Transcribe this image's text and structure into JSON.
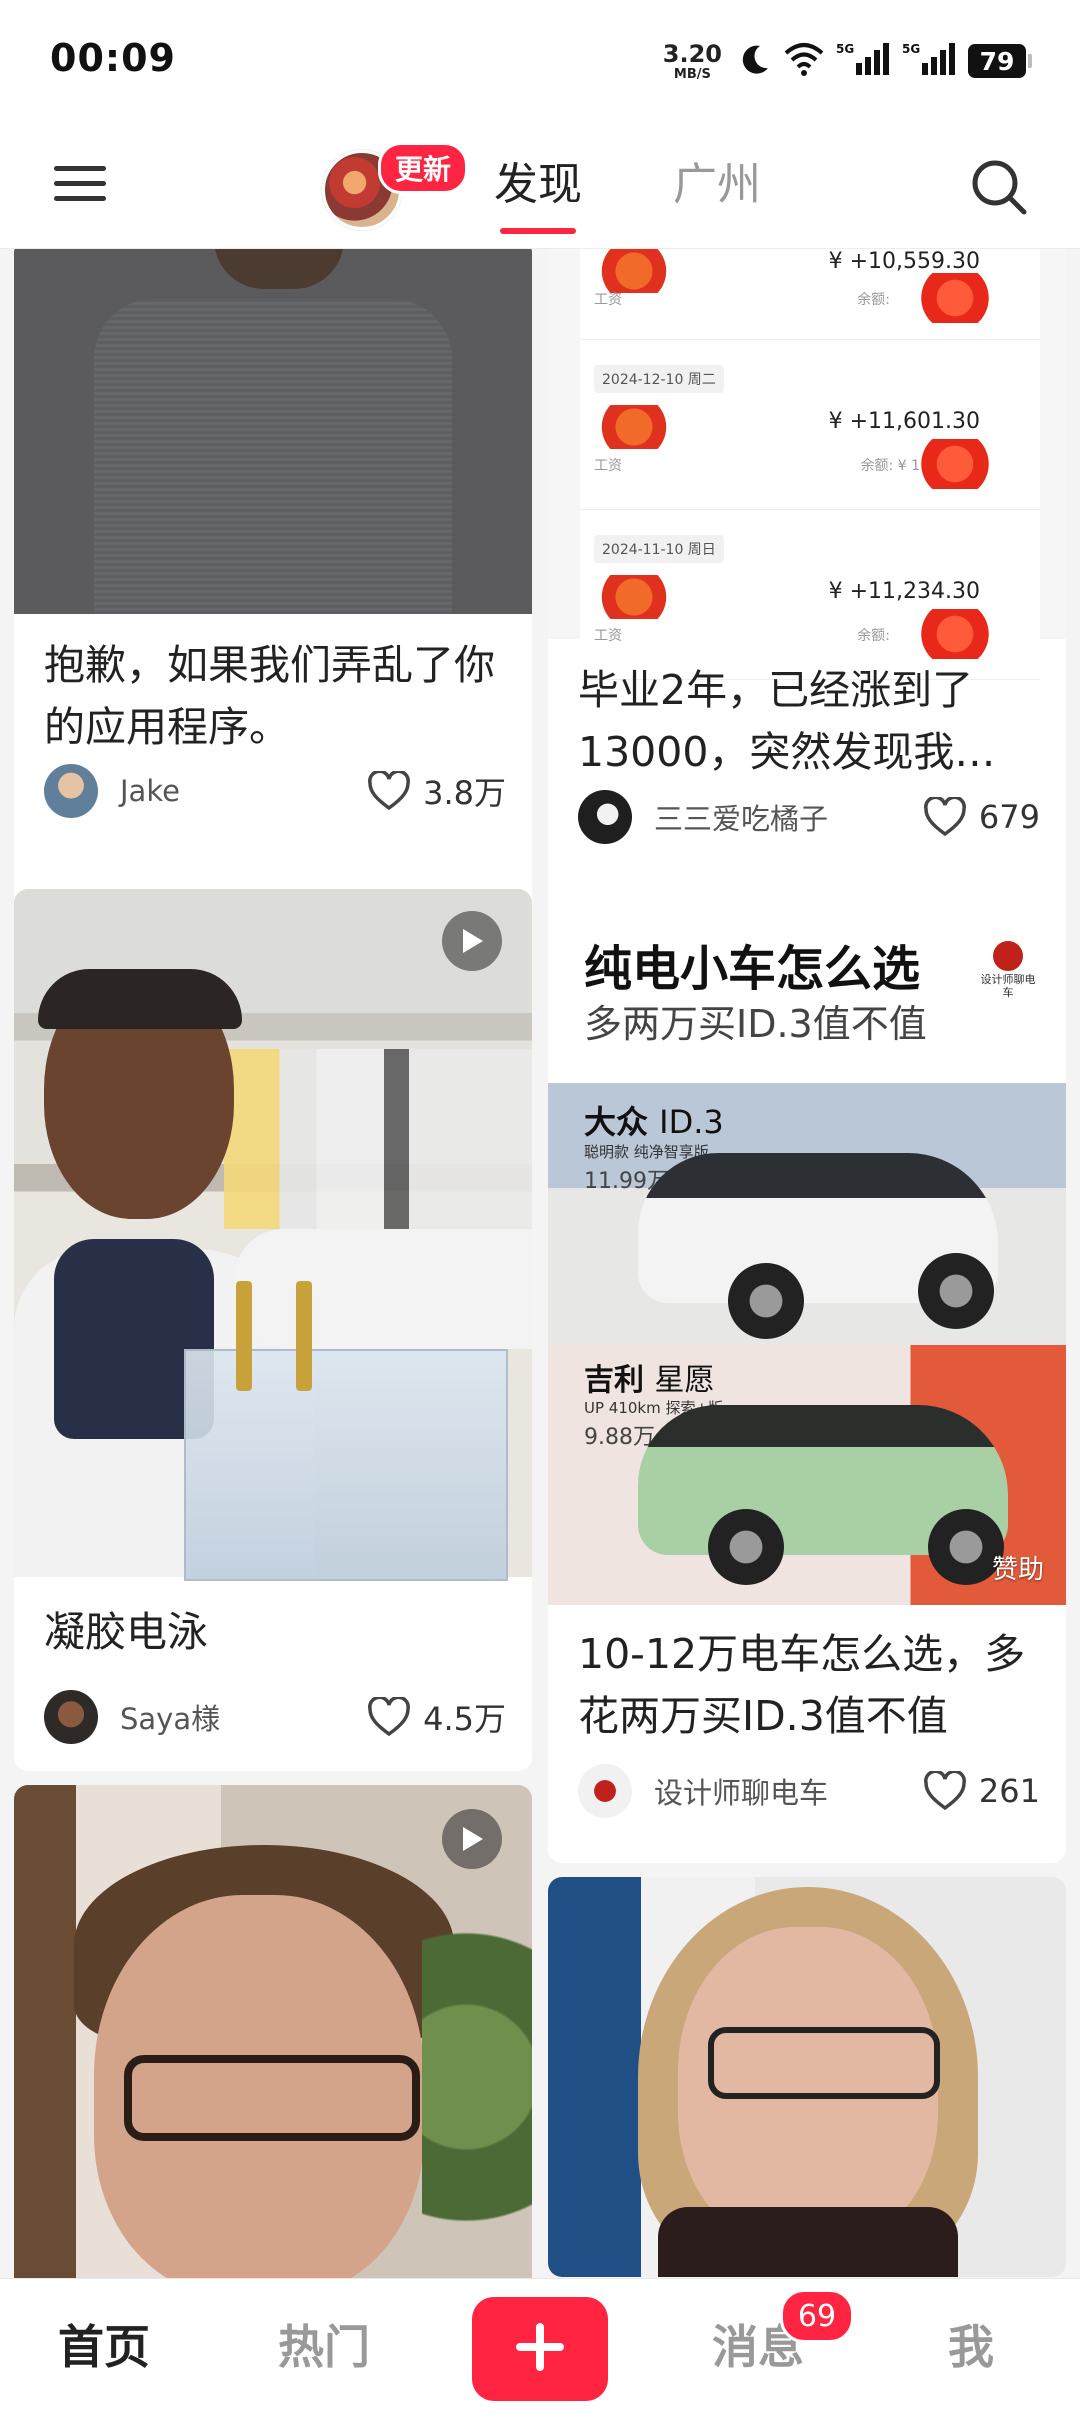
{
  "status_bar": {
    "time": "00:09",
    "net_speed_value": "3.20",
    "net_speed_unit": "MB/S",
    "signal_1_label": "5G",
    "signal_2_label": "5G",
    "battery": "79"
  },
  "top_nav": {
    "update_badge": "更新",
    "tabs": [
      {
        "label": "发现",
        "active": true
      },
      {
        "label": "广州",
        "active": false
      }
    ]
  },
  "feed": {
    "cards": [
      {
        "title": "抱歉，如果我们弄乱了你的应用程序。",
        "author": "Jake",
        "likes": "3.8万",
        "is_video": false
      },
      {
        "title": "毕业2年，已经涨到了13000，突然发现我…",
        "author": "三三爱吃橘子",
        "likes": "679",
        "is_video": false,
        "cover": {
          "rows": [
            {
              "date": "",
              "amount": "¥ +10,559.30",
              "sub": "工资",
              "balance": "余额:"
            },
            {
              "date": "2024-12-10 周二",
              "amount": "¥ +11,601.30",
              "sub": "工资",
              "balance": "余额: ¥ 1"
            },
            {
              "date": "2024-11-10 周日",
              "amount": "¥ +11,234.30",
              "sub": "工资",
              "balance": "余额:"
            }
          ]
        }
      },
      {
        "title": "凝胶电泳",
        "author": "Saya様",
        "likes": "4.5万",
        "is_video": true
      },
      {
        "title": "10-12万电车怎么选，多花两万买ID.3值不值",
        "author": "设计师聊电车",
        "likes": "261",
        "is_video": false,
        "cover": {
          "headline": "纯电小车怎么选",
          "subheadline": "多两万买ID.3值不值",
          "logo_text": "设计师聊电车",
          "car1_brand": "大众",
          "car1_model": "ID.3",
          "car1_spec": "聪明款 纯净智享版",
          "car1_price": "11.99万",
          "car2_brand": "吉利",
          "car2_model": "星愿",
          "car2_spec": "UP 410km 探索+版",
          "car2_price": "9.88万",
          "sponsor": "赞助"
        }
      },
      {
        "is_video": true
      },
      {
        "is_video": false
      }
    ]
  },
  "bottom_nav": {
    "home": "首页",
    "hot": "热门",
    "messages": "消息",
    "messages_badge": "69",
    "me": "我"
  },
  "colors": {
    "accent": "#ff2442",
    "text_primary": "#222222",
    "text_muted": "#999999"
  },
  "icons": [
    "menu-icon",
    "search-icon",
    "heart-icon",
    "play-icon",
    "plus-icon",
    "wifi-icon",
    "moon-icon",
    "signal-icon",
    "battery-icon"
  ]
}
